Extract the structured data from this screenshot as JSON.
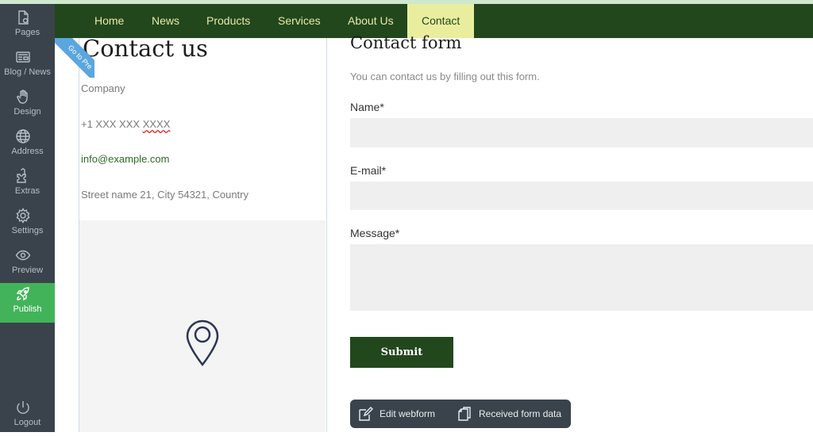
{
  "sidebar": {
    "items": [
      {
        "label": "Pages",
        "icon": "page-icon"
      },
      {
        "label": "Blog / News",
        "icon": "blog-icon"
      },
      {
        "label": "Design",
        "icon": "hand-icon"
      },
      {
        "label": "Address",
        "icon": "globe-icon"
      },
      {
        "label": "Extras",
        "icon": "puzzle-icon"
      },
      {
        "label": "Settings",
        "icon": "gear-icon"
      },
      {
        "label": "Preview",
        "icon": "eye-icon"
      },
      {
        "label": "Publish",
        "icon": "rocket-icon",
        "active": true
      }
    ],
    "logout": "Logout"
  },
  "nav": {
    "items": [
      "Home",
      "News",
      "Products",
      "Services",
      "About Us",
      "Contact"
    ],
    "active": "Contact"
  },
  "ribbon": {
    "text": "Go to Pre"
  },
  "contact": {
    "title": "Contact us",
    "company": "Company",
    "phone_prefix": "+1 XXX XXX ",
    "phone_suffix": "XXXX",
    "email": "info@example.com",
    "address": "Street name 21, City 54321, Country"
  },
  "form": {
    "title": "Contact form",
    "description": "You can contact us by filling out this form.",
    "name_label": "Name*",
    "email_label": "E-mail*",
    "message_label": "Message*",
    "submit_label": "Submit"
  },
  "toolbar": {
    "edit_label": "Edit webform",
    "received_label": "Received form data"
  },
  "colors": {
    "nav_bg": "#22471d",
    "nav_text": "#e9e9a6",
    "sidebar_bg": "#3a434b",
    "publish_green": "#43b35a",
    "accent_blue": "#5ba6df"
  }
}
